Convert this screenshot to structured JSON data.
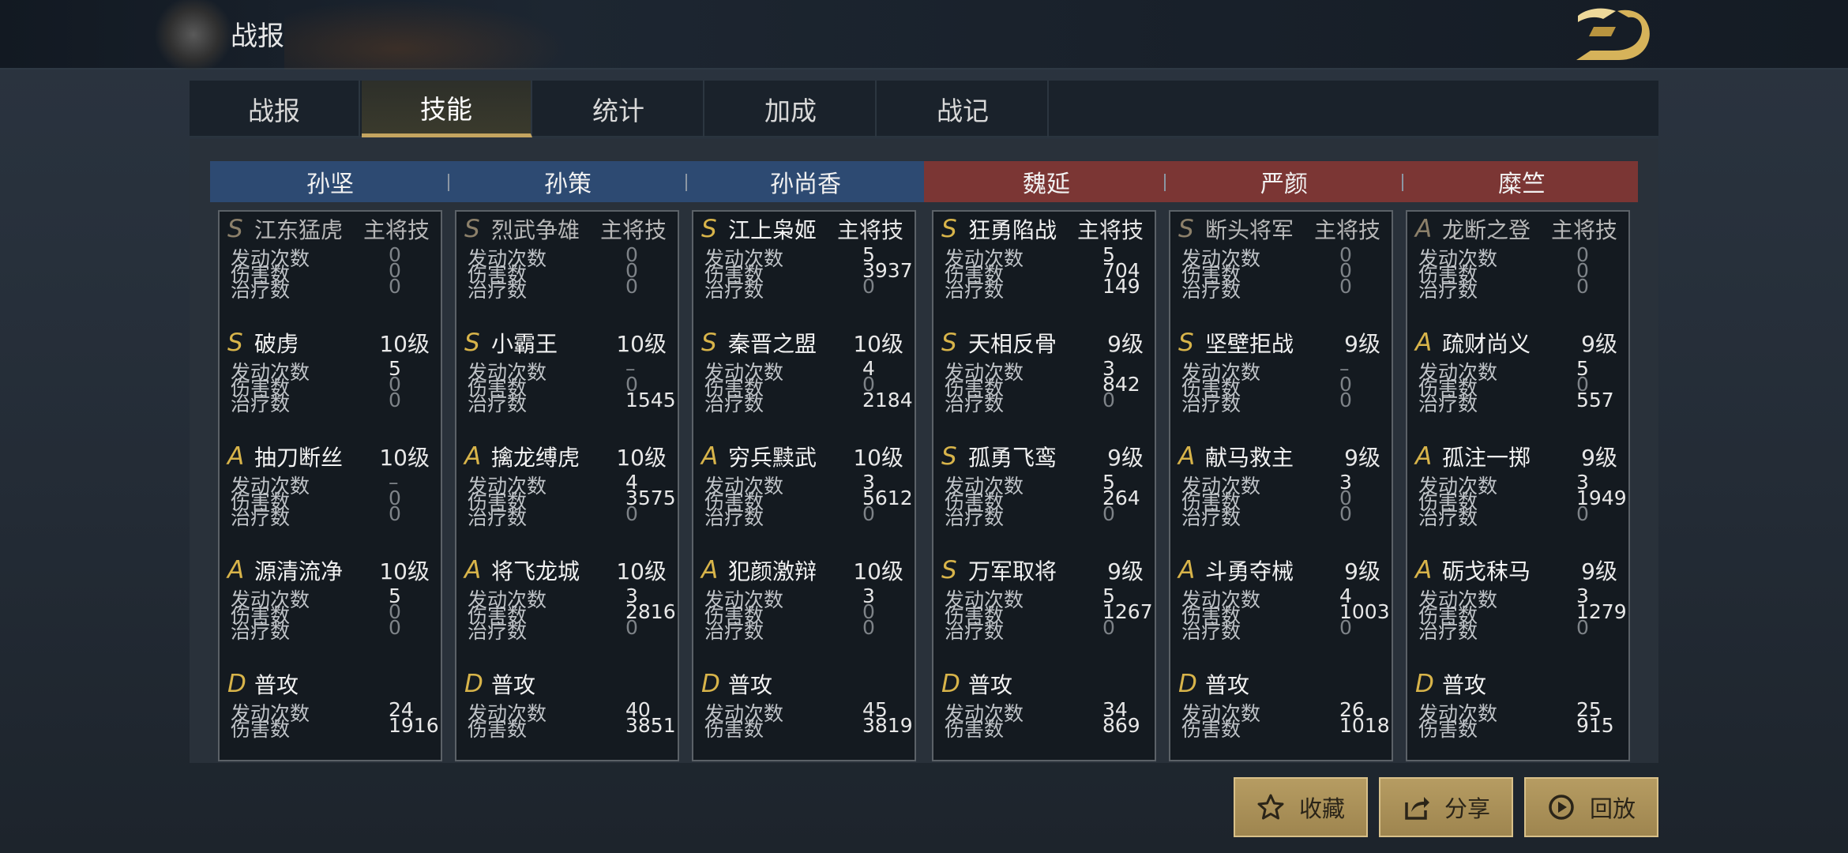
{
  "header": {
    "title": "战报"
  },
  "tabs": [
    {
      "label": "战报",
      "active": false
    },
    {
      "label": "技能",
      "active": true
    },
    {
      "label": "统计",
      "active": false
    },
    {
      "label": "加成",
      "active": false
    },
    {
      "label": "战记",
      "active": false
    }
  ],
  "teams": [
    {
      "color": "#2d4a72"
    },
    {
      "color": "#7b3634"
    }
  ],
  "generals": [
    {
      "name": "孙坚",
      "team": 0,
      "skills": [
        {
          "grade": "S",
          "name": "江东猛虎",
          "right": "主将技",
          "dim": true,
          "stats": [
            {
              "label": "发动次数",
              "value": "0",
              "zero": true
            },
            {
              "label": "伤害数",
              "value": "0",
              "zero": true
            },
            {
              "label": "治疗数",
              "value": "0",
              "zero": true
            }
          ]
        },
        {
          "grade": "S",
          "name": "破虏",
          "right": "10级",
          "stats": [
            {
              "label": "发动次数",
              "value": "5"
            },
            {
              "label": "伤害数",
              "value": "0",
              "zero": true
            },
            {
              "label": "治疗数",
              "value": "0",
              "zero": true
            }
          ]
        },
        {
          "grade": "A",
          "name": "抽刀断丝",
          "right": "10级",
          "stats": [
            {
              "label": "发动次数",
              "value": "–",
              "zero": true
            },
            {
              "label": "伤害数",
              "value": "0",
              "zero": true
            },
            {
              "label": "治疗数",
              "value": "0",
              "zero": true
            }
          ]
        },
        {
          "grade": "A",
          "name": "源清流净",
          "right": "10级",
          "stats": [
            {
              "label": "发动次数",
              "value": "5"
            },
            {
              "label": "伤害数",
              "value": "0",
              "zero": true
            },
            {
              "label": "治疗数",
              "value": "0",
              "zero": true
            }
          ]
        },
        {
          "grade": "D",
          "name": "普攻",
          "right": "",
          "stats": [
            {
              "label": "发动次数",
              "value": "24"
            },
            {
              "label": "伤害数",
              "value": "1916"
            }
          ]
        }
      ]
    },
    {
      "name": "孙策",
      "team": 0,
      "skills": [
        {
          "grade": "S",
          "name": "烈武争雄",
          "right": "主将技",
          "dim": true,
          "stats": [
            {
              "label": "发动次数",
              "value": "0",
              "zero": true
            },
            {
              "label": "伤害数",
              "value": "0",
              "zero": true
            },
            {
              "label": "治疗数",
              "value": "0",
              "zero": true
            }
          ]
        },
        {
          "grade": "S",
          "name": "小霸王",
          "right": "10级",
          "stats": [
            {
              "label": "发动次数",
              "value": "–",
              "zero": true
            },
            {
              "label": "伤害数",
              "value": "0",
              "zero": true
            },
            {
              "label": "治疗数",
              "value": "1545"
            }
          ]
        },
        {
          "grade": "A",
          "name": "擒龙缚虎",
          "right": "10级",
          "stats": [
            {
              "label": "发动次数",
              "value": "4"
            },
            {
              "label": "伤害数",
              "value": "3575"
            },
            {
              "label": "治疗数",
              "value": "0",
              "zero": true
            }
          ]
        },
        {
          "grade": "A",
          "name": "将飞龙城",
          "right": "10级",
          "stats": [
            {
              "label": "发动次数",
              "value": "3"
            },
            {
              "label": "伤害数",
              "value": "2816"
            },
            {
              "label": "治疗数",
              "value": "0",
              "zero": true
            }
          ]
        },
        {
          "grade": "D",
          "name": "普攻",
          "right": "",
          "stats": [
            {
              "label": "发动次数",
              "value": "40"
            },
            {
              "label": "伤害数",
              "value": "3851"
            }
          ]
        }
      ]
    },
    {
      "name": "孙尚香",
      "team": 0,
      "skills": [
        {
          "grade": "S",
          "name": "江上枭姬",
          "right": "主将技",
          "stats": [
            {
              "label": "发动次数",
              "value": "5"
            },
            {
              "label": "伤害数",
              "value": "3937"
            },
            {
              "label": "治疗数",
              "value": "0",
              "zero": true
            }
          ]
        },
        {
          "grade": "S",
          "name": "秦晋之盟",
          "right": "10级",
          "stats": [
            {
              "label": "发动次数",
              "value": "4"
            },
            {
              "label": "伤害数",
              "value": "0",
              "zero": true
            },
            {
              "label": "治疗数",
              "value": "2184"
            }
          ]
        },
        {
          "grade": "A",
          "name": "穷兵黩武",
          "right": "10级",
          "stats": [
            {
              "label": "发动次数",
              "value": "3"
            },
            {
              "label": "伤害数",
              "value": "5612"
            },
            {
              "label": "治疗数",
              "value": "0",
              "zero": true
            }
          ]
        },
        {
          "grade": "A",
          "name": "犯颜激辩",
          "right": "10级",
          "stats": [
            {
              "label": "发动次数",
              "value": "3"
            },
            {
              "label": "伤害数",
              "value": "0",
              "zero": true
            },
            {
              "label": "治疗数",
              "value": "0",
              "zero": true
            }
          ]
        },
        {
          "grade": "D",
          "name": "普攻",
          "right": "",
          "stats": [
            {
              "label": "发动次数",
              "value": "45"
            },
            {
              "label": "伤害数",
              "value": "3819"
            }
          ]
        }
      ]
    },
    {
      "name": "魏延",
      "team": 1,
      "skills": [
        {
          "grade": "S",
          "name": "狂勇陷战",
          "right": "主将技",
          "stats": [
            {
              "label": "发动次数",
              "value": "5"
            },
            {
              "label": "伤害数",
              "value": "704"
            },
            {
              "label": "治疗数",
              "value": "149"
            }
          ]
        },
        {
          "grade": "S",
          "name": "天相反骨",
          "right": "9级",
          "stats": [
            {
              "label": "发动次数",
              "value": "3"
            },
            {
              "label": "伤害数",
              "value": "842"
            },
            {
              "label": "治疗数",
              "value": "0",
              "zero": true
            }
          ]
        },
        {
          "grade": "S",
          "name": "孤勇飞鸾",
          "right": "9级",
          "stats": [
            {
              "label": "发动次数",
              "value": "5"
            },
            {
              "label": "伤害数",
              "value": "264"
            },
            {
              "label": "治疗数",
              "value": "0",
              "zero": true
            }
          ]
        },
        {
          "grade": "S",
          "name": "万军取将",
          "right": "9级",
          "stats": [
            {
              "label": "发动次数",
              "value": "5"
            },
            {
              "label": "伤害数",
              "value": "1267"
            },
            {
              "label": "治疗数",
              "value": "0",
              "zero": true
            }
          ]
        },
        {
          "grade": "D",
          "name": "普攻",
          "right": "",
          "stats": [
            {
              "label": "发动次数",
              "value": "34"
            },
            {
              "label": "伤害数",
              "value": "869"
            }
          ]
        }
      ]
    },
    {
      "name": "严颜",
      "team": 1,
      "skills": [
        {
          "grade": "S",
          "name": "断头将军",
          "right": "主将技",
          "dim": true,
          "stats": [
            {
              "label": "发动次数",
              "value": "0",
              "zero": true
            },
            {
              "label": "伤害数",
              "value": "0",
              "zero": true
            },
            {
              "label": "治疗数",
              "value": "0",
              "zero": true
            }
          ]
        },
        {
          "grade": "S",
          "name": "坚壁拒战",
          "right": "9级",
          "stats": [
            {
              "label": "发动次数",
              "value": "–",
              "zero": true
            },
            {
              "label": "伤害数",
              "value": "0",
              "zero": true
            },
            {
              "label": "治疗数",
              "value": "0",
              "zero": true
            }
          ]
        },
        {
          "grade": "A",
          "name": "献马救主",
          "right": "9级",
          "stats": [
            {
              "label": "发动次数",
              "value": "3"
            },
            {
              "label": "伤害数",
              "value": "0",
              "zero": true
            },
            {
              "label": "治疗数",
              "value": "0",
              "zero": true
            }
          ]
        },
        {
          "grade": "A",
          "name": "斗勇夺械",
          "right": "9级",
          "stats": [
            {
              "label": "发动次数",
              "value": "4"
            },
            {
              "label": "伤害数",
              "value": "1003"
            },
            {
              "label": "治疗数",
              "value": "0",
              "zero": true
            }
          ]
        },
        {
          "grade": "D",
          "name": "普攻",
          "right": "",
          "stats": [
            {
              "label": "发动次数",
              "value": "26"
            },
            {
              "label": "伤害数",
              "value": "1018"
            }
          ]
        }
      ]
    },
    {
      "name": "糜竺",
      "team": 1,
      "skills": [
        {
          "grade": "A",
          "name": "龙断之登",
          "right": "主将技",
          "dim": true,
          "stats": [
            {
              "label": "发动次数",
              "value": "0",
              "zero": true
            },
            {
              "label": "伤害数",
              "value": "0",
              "zero": true
            },
            {
              "label": "治疗数",
              "value": "0",
              "zero": true
            }
          ]
        },
        {
          "grade": "A",
          "name": "疏财尚义",
          "right": "9级",
          "stats": [
            {
              "label": "发动次数",
              "value": "5"
            },
            {
              "label": "伤害数",
              "value": "0",
              "zero": true
            },
            {
              "label": "治疗数",
              "value": "557"
            }
          ]
        },
        {
          "grade": "A",
          "name": "孤注一掷",
          "right": "9级",
          "stats": [
            {
              "label": "发动次数",
              "value": "3"
            },
            {
              "label": "伤害数",
              "value": "1949"
            },
            {
              "label": "治疗数",
              "value": "0",
              "zero": true
            }
          ]
        },
        {
          "grade": "A",
          "name": "砺戈秣马",
          "right": "9级",
          "stats": [
            {
              "label": "发动次数",
              "value": "3"
            },
            {
              "label": "伤害数",
              "value": "1279"
            },
            {
              "label": "治疗数",
              "value": "0",
              "zero": true
            }
          ]
        },
        {
          "grade": "D",
          "name": "普攻",
          "right": "",
          "stats": [
            {
              "label": "发动次数",
              "value": "25"
            },
            {
              "label": "伤害数",
              "value": "915"
            }
          ]
        }
      ]
    }
  ],
  "buttons": [
    {
      "label": "收藏",
      "icon": "star-icon"
    },
    {
      "label": "分享",
      "icon": "share-icon"
    },
    {
      "label": "回放",
      "icon": "replay-icon"
    }
  ],
  "accent": "#c4a560"
}
